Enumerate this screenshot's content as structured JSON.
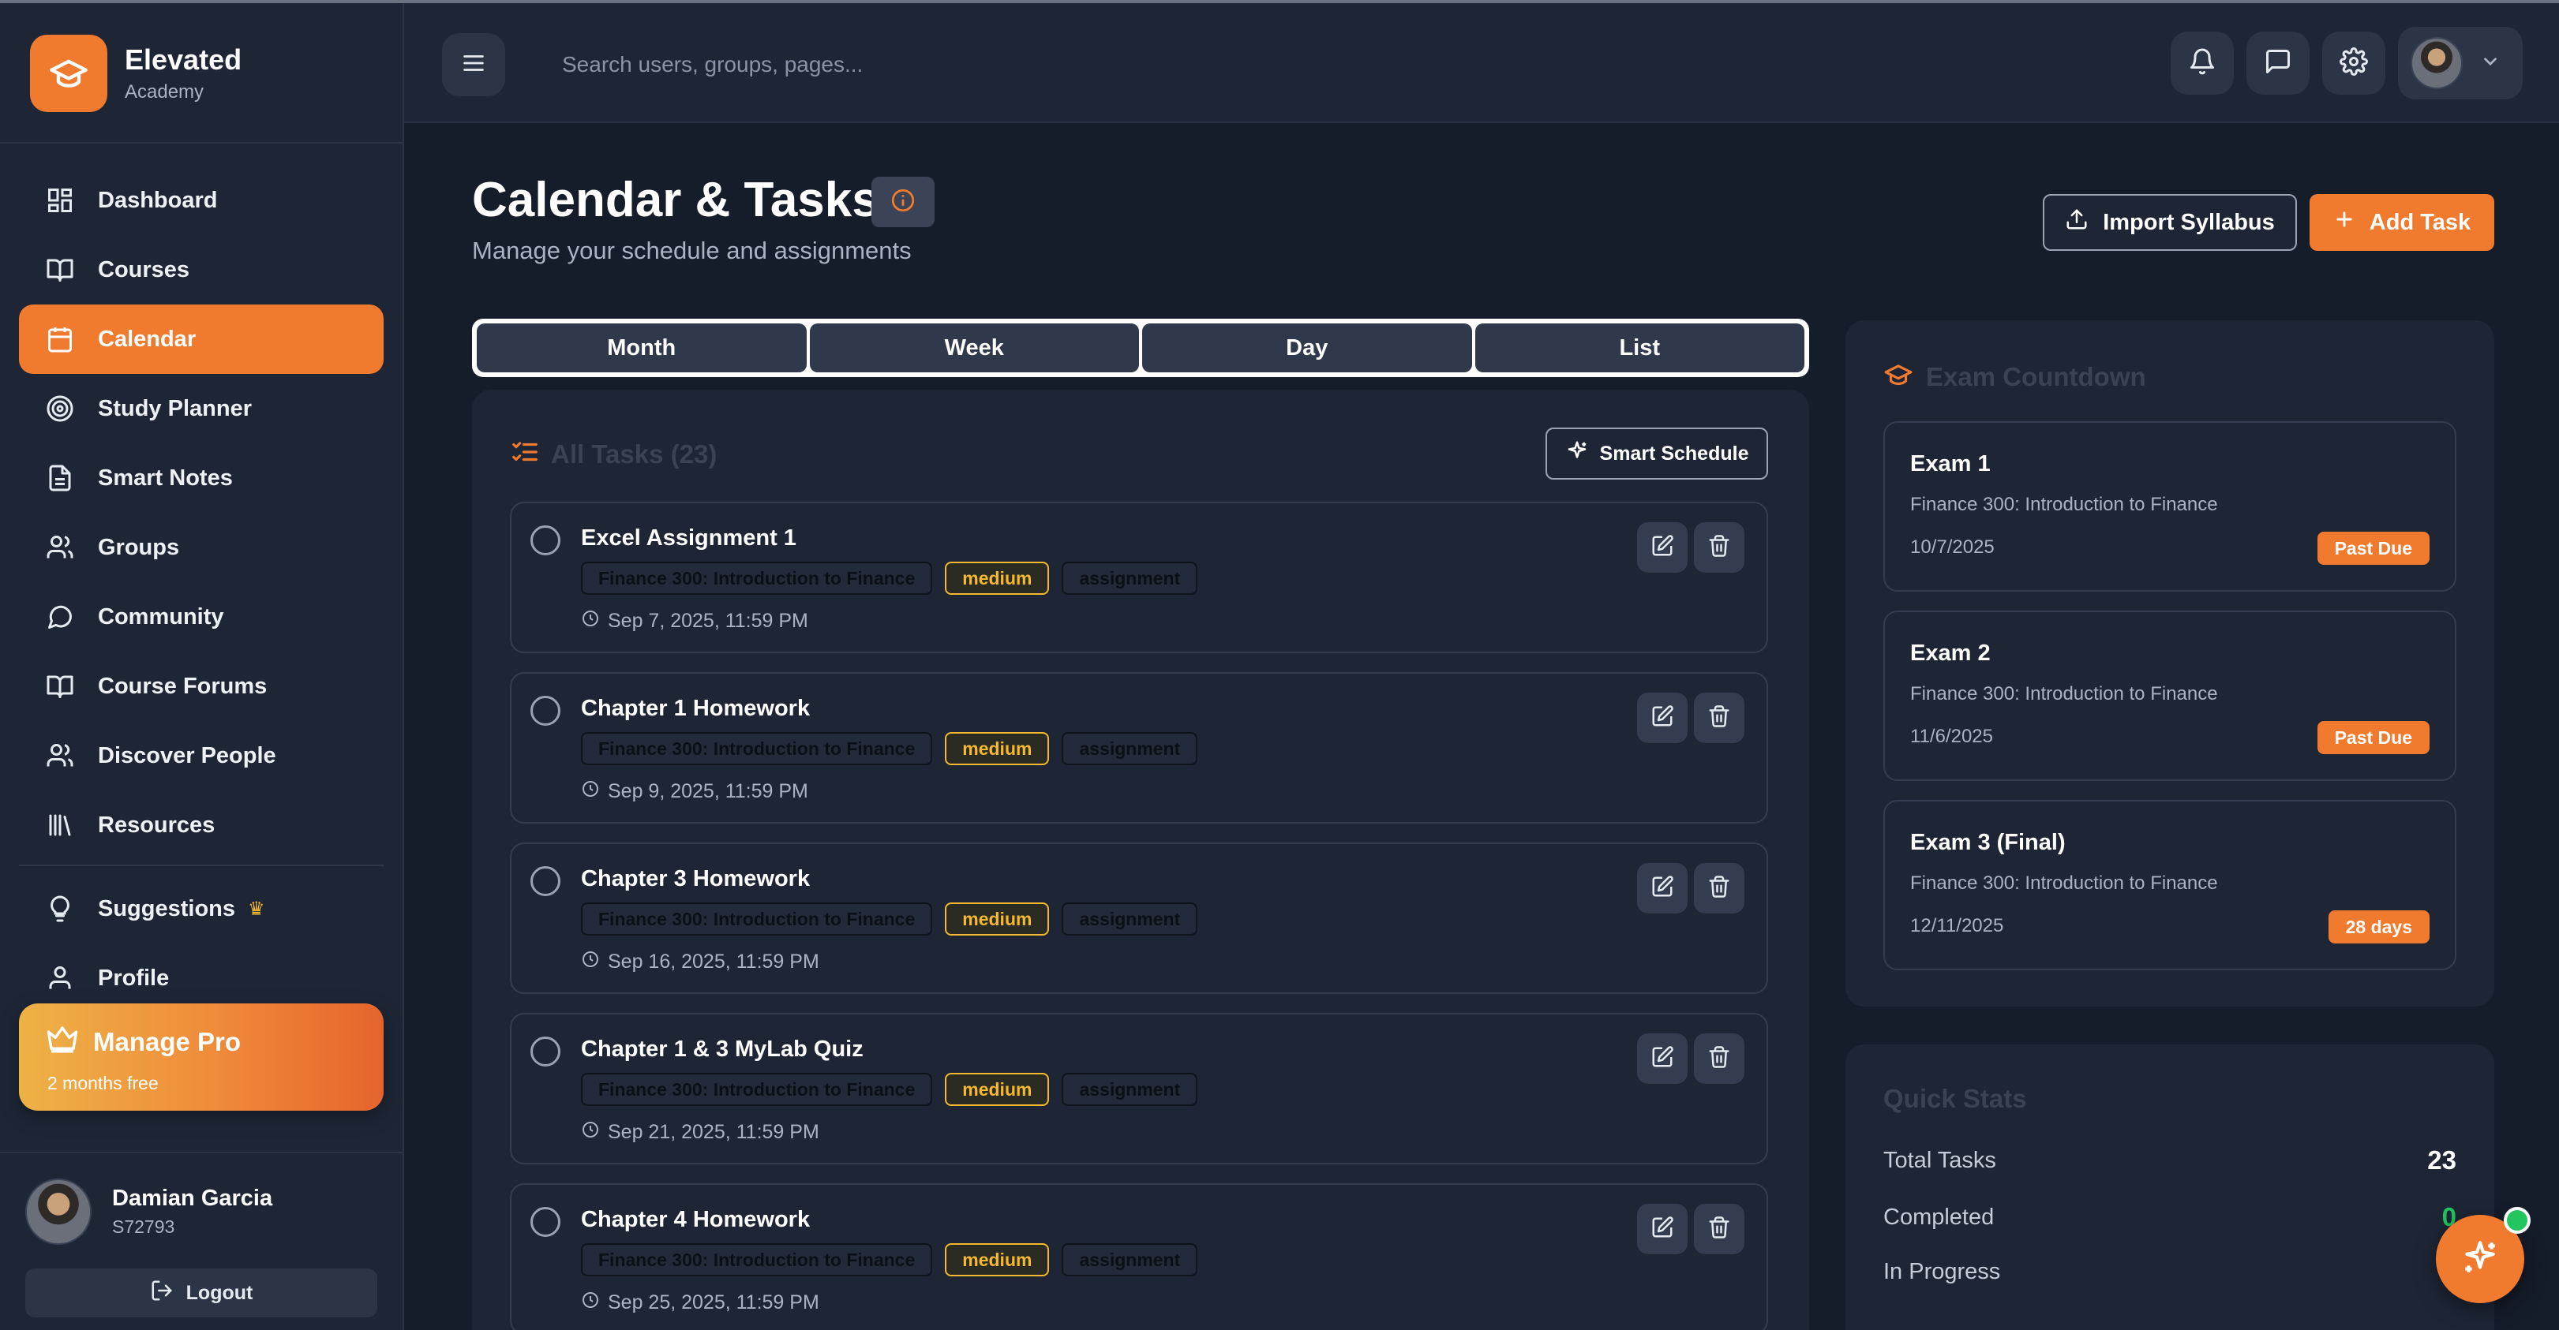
{
  "brand": {
    "name": "Elevated",
    "sub": "Academy"
  },
  "nav": {
    "items": [
      {
        "label": "Dashboard"
      },
      {
        "label": "Courses"
      },
      {
        "label": "Calendar"
      },
      {
        "label": "Study Planner"
      },
      {
        "label": "Smart Notes"
      },
      {
        "label": "Groups"
      },
      {
        "label": "Community"
      },
      {
        "label": "Course Forums"
      },
      {
        "label": "Discover People"
      },
      {
        "label": "Resources"
      }
    ],
    "secondary": [
      {
        "label": "Suggestions"
      },
      {
        "label": "Profile"
      }
    ],
    "active": "Calendar"
  },
  "pro": {
    "title": "Manage Pro",
    "sub": "2 months free"
  },
  "user": {
    "name": "Damian Garcia",
    "id": "S72793",
    "logout": "Logout"
  },
  "topbar": {
    "search_placeholder": "Search users, groups, pages..."
  },
  "page": {
    "title": "Calendar & Tasks",
    "subtitle": "Manage your schedule and assignments",
    "import_label": "Import Syllabus",
    "add_label": "Add Task"
  },
  "view_tabs": [
    "Month",
    "Week",
    "Day",
    "List"
  ],
  "tasks": {
    "heading": "All Tasks (23)",
    "smart_label": "Smart Schedule",
    "items": [
      {
        "title": "Excel Assignment 1",
        "course": "Finance 300: Introduction to Finance",
        "priority": "medium",
        "type": "assignment",
        "due": "Sep 7, 2025, 11:59 PM"
      },
      {
        "title": "Chapter 1 Homework",
        "course": "Finance 300: Introduction to Finance",
        "priority": "medium",
        "type": "assignment",
        "due": "Sep 9, 2025, 11:59 PM"
      },
      {
        "title": "Chapter 3 Homework",
        "course": "Finance 300: Introduction to Finance",
        "priority": "medium",
        "type": "assignment",
        "due": "Sep 16, 2025, 11:59 PM"
      },
      {
        "title": "Chapter 1 & 3 MyLab Quiz",
        "course": "Finance 300: Introduction to Finance",
        "priority": "medium",
        "type": "assignment",
        "due": "Sep 21, 2025, 11:59 PM"
      },
      {
        "title": "Chapter 4 Homework",
        "course": "Finance 300: Introduction to Finance",
        "priority": "medium",
        "type": "assignment",
        "due": "Sep 25, 2025, 11:59 PM"
      }
    ]
  },
  "exams": {
    "heading": "Exam Countdown",
    "items": [
      {
        "name": "Exam 1",
        "course": "Finance 300: Introduction to Finance",
        "date": "10/7/2025",
        "badge": "Past Due"
      },
      {
        "name": "Exam 2",
        "course": "Finance 300: Introduction to Finance",
        "date": "11/6/2025",
        "badge": "Past Due"
      },
      {
        "name": "Exam 3 (Final)",
        "course": "Finance 300: Introduction to Finance",
        "date": "12/11/2025",
        "badge": "28 days"
      }
    ]
  },
  "stats": {
    "heading": "Quick Stats",
    "rows": [
      {
        "label": "Total Tasks",
        "value": "23"
      },
      {
        "label": "Completed",
        "value": "0"
      },
      {
        "label": "In Progress",
        "value": ""
      }
    ]
  },
  "colors": {
    "accent": "#f07a2e",
    "background": "#151c2a",
    "panel": "#1e2636",
    "priority": "#f5b82e",
    "online": "#22c55e"
  },
  "icons": {
    "brand": "graduation-cap-icon",
    "fab": "sparkle-icon"
  }
}
